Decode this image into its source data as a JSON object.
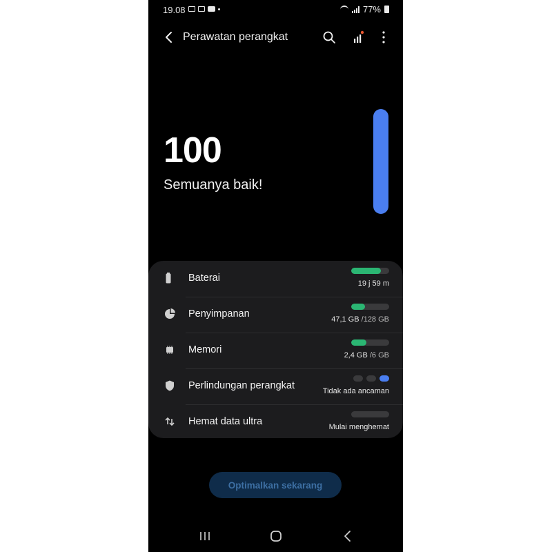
{
  "status_bar": {
    "time": "19.08",
    "battery_percent": "77%",
    "notification_icons": [
      "gallery-icon",
      "mail-icon",
      "youtube-icon",
      "dot"
    ]
  },
  "header": {
    "title": "Perawatan perangkat",
    "actions": [
      "search-icon",
      "signal-icon",
      "more-icon"
    ]
  },
  "score": {
    "value": "100",
    "message": "Semuanya baik!",
    "gauge_color": "#4a7ef0"
  },
  "items": [
    {
      "label": "Baterai",
      "value": "19 j 59 m",
      "fill": 0.78,
      "icon": "battery-icon"
    },
    {
      "label": "Penyimpanan",
      "value": "47,1 GB",
      "total": "/128 GB",
      "fill": 0.37,
      "icon": "storage-pie-icon"
    },
    {
      "label": "Memori",
      "value": "2,4 GB",
      "total": "/6 GB",
      "fill": 0.4,
      "icon": "memory-chip-icon"
    },
    {
      "label": "Perlindungan perangkat",
      "value": "Tidak ada ancaman",
      "icon": "shield-icon"
    },
    {
      "label": "Hemat data ultra",
      "value": "Mulai menghemat",
      "fill": 0,
      "icon": "data-saver-icon"
    }
  ],
  "colors": {
    "accent_blue": "#4a7ef0",
    "bar_green": "#2bb673",
    "card_bg": "#1c1c1e"
  },
  "optimize_button": {
    "label": "Optimalkan sekarang"
  }
}
